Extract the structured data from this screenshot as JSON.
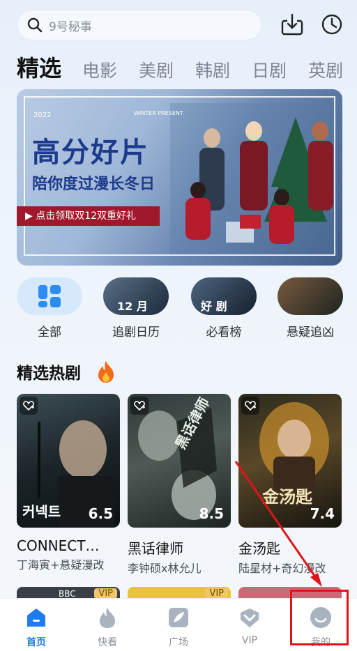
{
  "search": {
    "placeholder": "9号秘事",
    "icon": "search-icon"
  },
  "top_icons": [
    "download-icon",
    "history-icon"
  ],
  "tabs": [
    {
      "label": "精选",
      "active": true
    },
    {
      "label": "电影"
    },
    {
      "label": "美剧"
    },
    {
      "label": "韩剧"
    },
    {
      "label": "日剧"
    },
    {
      "label": "英剧"
    }
  ],
  "banner": {
    "year": "2022",
    "tag": "WINTER PRESENT",
    "title": "高分好片",
    "subtitle": "陪你度过漫长冬日",
    "cta": "点击领取双12双重好礼"
  },
  "categories": [
    {
      "label": "全部",
      "pill_text": ""
    },
    {
      "label": "追剧日历",
      "pill_text": "12 月"
    },
    {
      "label": "必看榜",
      "pill_text": "好 剧"
    },
    {
      "label": "悬疑追凶",
      "pill_text": ""
    }
  ],
  "section": {
    "title": "精选热剧"
  },
  "dramas": [
    {
      "name": "CONNECT…",
      "desc": "丁海寅+悬疑漫改",
      "score": "6.5",
      "poster_text": "커넥트"
    },
    {
      "name": "黑话律师",
      "desc": "李钟硕x林允儿",
      "score": "8.5",
      "poster_text": "黑话律师"
    },
    {
      "name": "金汤匙",
      "desc": "陆星材+奇幻漫改",
      "score": "7.4",
      "poster_text": "金汤匙"
    }
  ],
  "bottom_posters": [
    {
      "badge": "VIP",
      "label": "BBC"
    },
    {
      "badge": "VIP",
      "label": ""
    },
    {
      "badge": "",
      "label": ""
    }
  ],
  "nav": [
    {
      "label": "首页",
      "icon": "home-icon",
      "active": true
    },
    {
      "label": "快看",
      "icon": "flame-icon"
    },
    {
      "label": "广场",
      "icon": "feather-icon"
    },
    {
      "label": "VIP",
      "icon": "vip-icon"
    },
    {
      "label": "我的",
      "icon": "profile-icon"
    }
  ],
  "colors": {
    "accent": "#1e7cf0",
    "highlight": "#e0141a",
    "banner_cta": "#a0182b"
  }
}
